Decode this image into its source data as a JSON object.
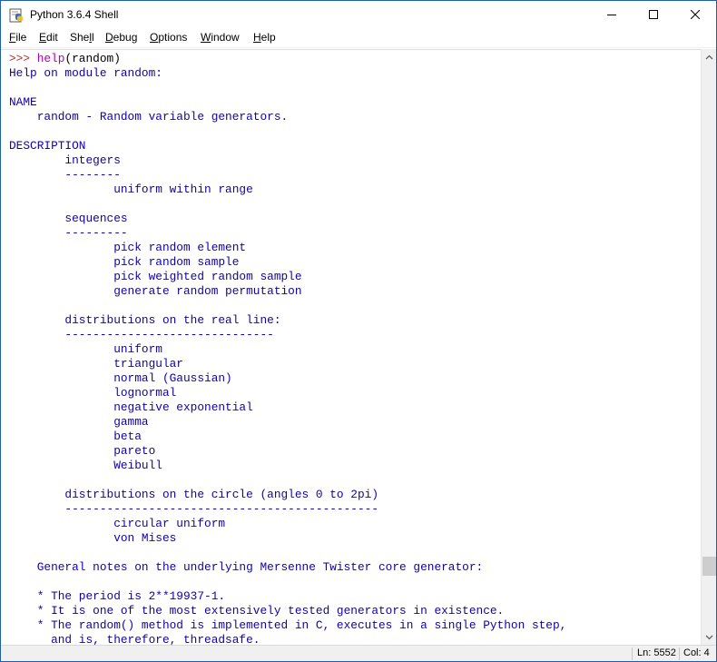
{
  "window": {
    "title": "Python 3.6.4 Shell"
  },
  "menu": {
    "items": [
      {
        "label": "File",
        "underline": "F",
        "rest": "ile"
      },
      {
        "label": "Edit",
        "underline": "E",
        "rest": "dit"
      },
      {
        "label": "Shell",
        "pre": "She",
        "underline": "l",
        "rest": "l"
      },
      {
        "label": "Debug",
        "underline": "D",
        "rest": "ebug"
      },
      {
        "label": "Options",
        "underline": "O",
        "rest": "ptions"
      },
      {
        "label": "Window",
        "underline": "W",
        "rest": "indow"
      },
      {
        "label": "Help",
        "underline": "H",
        "rest": "elp"
      }
    ]
  },
  "shell": {
    "prompt": ">>> ",
    "command_name": "help",
    "command_args": "(random)",
    "output_lines": [
      "Help on module random:",
      "",
      "NAME",
      "    random - Random variable generators.",
      "",
      "DESCRIPTION",
      "        integers",
      "        --------",
      "               uniform within range",
      "",
      "        sequences",
      "        ---------",
      "               pick random element",
      "               pick random sample",
      "               pick weighted random sample",
      "               generate random permutation",
      "",
      "        distributions on the real line:",
      "        ------------------------------",
      "               uniform",
      "               triangular",
      "               normal (Gaussian)",
      "               lognormal",
      "               negative exponential",
      "               gamma",
      "               beta",
      "               pareto",
      "               Weibull",
      "",
      "        distributions on the circle (angles 0 to 2pi)",
      "        ---------------------------------------------",
      "               circular uniform",
      "               von Mises",
      "",
      "    General notes on the underlying Mersenne Twister core generator:",
      "",
      "    * The period is 2**19937-1.",
      "    * It is one of the most extensively tested generators in existence.",
      "    * The random() method is implemented in C, executes in a single Python step,",
      "      and is, therefore, threadsafe."
    ]
  },
  "status": {
    "line": "Ln: 5552",
    "col": "Col: 4"
  },
  "colors": {
    "output_text": "#1000b0",
    "prompt": "#b03030",
    "builtin": "#b000b0"
  }
}
